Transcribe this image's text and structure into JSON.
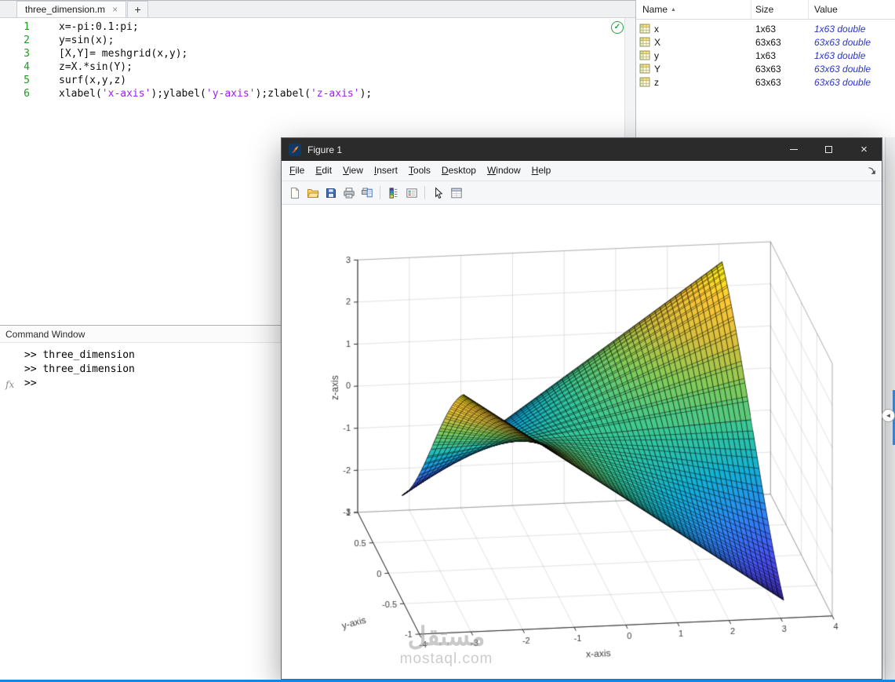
{
  "ui": {
    "rail_collapse_icon": "◄"
  },
  "editor": {
    "tab": {
      "title": "three_dimension.m",
      "close_icon": "×",
      "new_tab_icon": "+"
    },
    "analyzer_ok_icon": "✓",
    "lines": [
      {
        "n": "1",
        "segs": [
          {
            "t": "x=-pi:0.1:pi;",
            "c": "code"
          }
        ]
      },
      {
        "n": "2",
        "segs": [
          {
            "t": "y=sin(x);",
            "c": "code"
          }
        ]
      },
      {
        "n": "3",
        "segs": [
          {
            "t": "[X,Y]= meshgrid(x,y);",
            "c": "code"
          }
        ]
      },
      {
        "n": "4",
        "segs": [
          {
            "t": "z=X.*sin(Y);",
            "c": "code"
          }
        ]
      },
      {
        "n": "5",
        "segs": [
          {
            "t": "surf(x,y,z)",
            "c": "code"
          }
        ]
      },
      {
        "n": "6",
        "segs": [
          {
            "t": "xlabel(",
            "c": "code"
          },
          {
            "t": "'x-axis'",
            "c": "str"
          },
          {
            "t": ");ylabel(",
            "c": "code"
          },
          {
            "t": "'y-axis'",
            "c": "str"
          },
          {
            "t": ");zlabel(",
            "c": "code"
          },
          {
            "t": "'z-axis'",
            "c": "str"
          },
          {
            "t": ");",
            "c": "code"
          }
        ]
      }
    ]
  },
  "command_window": {
    "title": "Command Window",
    "history": [
      ">> three_dimension",
      ">> three_dimension"
    ],
    "prompt": ">>",
    "fx_label": "fx"
  },
  "workspace": {
    "columns": [
      "Name",
      "Size",
      "Value"
    ],
    "sort_icon": "▲",
    "rows": [
      {
        "name": "x",
        "size": "1x63",
        "value": "1x63 double"
      },
      {
        "name": "X",
        "size": "63x63",
        "value": "63x63 double"
      },
      {
        "name": "y",
        "size": "1x63",
        "value": "1x63 double"
      },
      {
        "name": "Y",
        "size": "63x63",
        "value": "63x63 double"
      },
      {
        "name": "z",
        "size": "63x63",
        "value": "63x63 double"
      }
    ]
  },
  "figure_window": {
    "title": "Figure 1",
    "window_icons": {
      "close": "×"
    },
    "menu": [
      "File",
      "Edit",
      "View",
      "Insert",
      "Tools",
      "Desktop",
      "Window",
      "Help"
    ],
    "toolbar_icons": [
      "new-script-icon",
      "open-icon",
      "save-icon",
      "print-icon",
      "print-preview-icon",
      "insert-colorbar-icon",
      "insert-legend-icon",
      "edit-plot-icon",
      "property-inspector-icon"
    ],
    "watermark": {
      "line1": "مستقل",
      "line2": "mostaql.com"
    }
  },
  "chart_data": {
    "type": "surface",
    "xlabel": "x-axis",
    "ylabel": "y-axis",
    "zlabel": "z-axis",
    "x_definition": "x = -pi:0.1:pi",
    "y_definition": "y = sin(x)",
    "z_definition": "z = X.*sin(Y) with [X,Y] = meshgrid(x,y)",
    "n": 63,
    "x_start": -3.141592653589793,
    "x_step": 0.1,
    "xlim": [
      -4,
      4
    ],
    "ylim": [
      -1,
      1
    ],
    "zlim": [
      -3,
      3
    ],
    "xticks": [
      -4,
      -3,
      -2,
      -1,
      0,
      1,
      2,
      3,
      4
    ],
    "yticks": [
      -1,
      -0.5,
      0,
      0.5,
      1
    ],
    "zticks": [
      -3,
      -2,
      -1,
      0,
      1,
      2,
      3
    ],
    "view": {
      "azimuth_deg": -8.5,
      "elevation_deg": 26
    },
    "colormap": "parula",
    "edge_color": "#000000",
    "grid": true
  }
}
